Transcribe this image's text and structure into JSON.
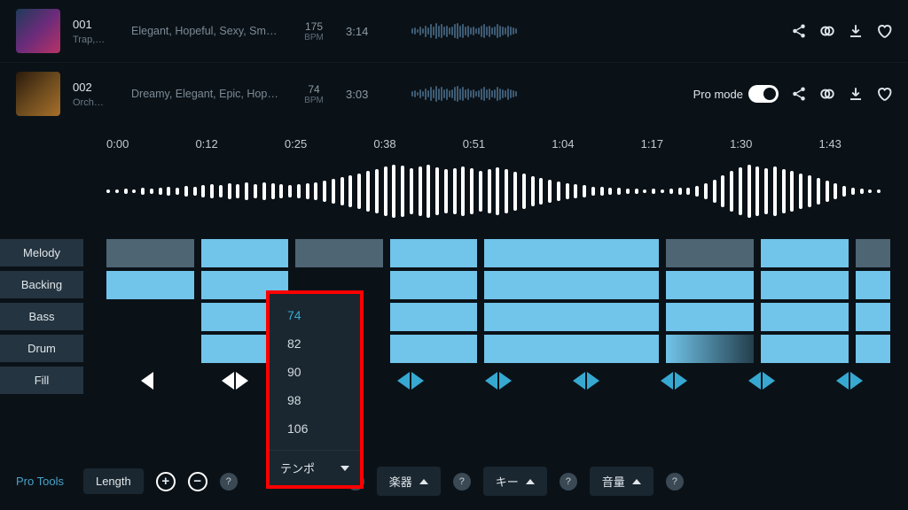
{
  "tracks": [
    {
      "num": "001",
      "genre": "Trap,…",
      "tags": "Elegant, Hopeful, Sexy, Smooth",
      "bpm": "175",
      "bpm_unit": "BPM",
      "duration": "3:14",
      "pro_mode": false
    },
    {
      "num": "002",
      "genre": "Orch…",
      "tags": "Dreamy, Elegant, Epic, Hopef…",
      "bpm": "74",
      "bpm_unit": "BPM",
      "duration": "3:03",
      "pro_mode": true,
      "pro_mode_label": "Pro mode"
    }
  ],
  "timeline": [
    "0:00",
    "0:12",
    "0:25",
    "0:38",
    "0:51",
    "1:04",
    "1:17",
    "1:30",
    "1:43"
  ],
  "lanes": {
    "melody": "Melody",
    "backing": "Backing",
    "bass": "Bass",
    "drum": "Drum",
    "fill": "Fill"
  },
  "tempo_menu": {
    "label": "テンポ",
    "selected": "74",
    "options": [
      "74",
      "82",
      "90",
      "98",
      "106"
    ]
  },
  "toolbar": {
    "title": "Pro Tools",
    "length": "Length",
    "tempo": "テンポ",
    "instrument": "楽器",
    "key": "キー",
    "volume": "音量"
  },
  "fill_markers": [
    {
      "left": true,
      "right": false,
      "color": "#ffffff"
    },
    {
      "left": true,
      "right": true,
      "color": "#ffffff"
    },
    {
      "left": true,
      "right": true,
      "color": "#ffffff"
    },
    {
      "left": true,
      "right": true,
      "color": "#37a9d1"
    },
    {
      "left": true,
      "right": true,
      "color": "#37a9d1"
    },
    {
      "left": true,
      "right": true,
      "color": "#37a9d1"
    },
    {
      "left": true,
      "right": true,
      "color": "#37a9d1"
    },
    {
      "left": true,
      "right": true,
      "color": "#37a9d1"
    },
    {
      "left": true,
      "right": true,
      "color": "#37a9d1"
    }
  ],
  "chart_data": {
    "type": "waveform",
    "note": "Decorative audio amplitude visualization; values are relative heights 0-1",
    "mini_wave": [
      0.2,
      0.3,
      0.15,
      0.4,
      0.25,
      0.5,
      0.3,
      0.6,
      0.4,
      0.7,
      0.5,
      0.6,
      0.4,
      0.5,
      0.3,
      0.4,
      0.6,
      0.7,
      0.5,
      0.6,
      0.4,
      0.5,
      0.3,
      0.4,
      0.2,
      0.3,
      0.5,
      0.6,
      0.4,
      0.5,
      0.3,
      0.4,
      0.6,
      0.5,
      0.4,
      0.3,
      0.5,
      0.4,
      0.3,
      0.2
    ],
    "big_wave": [
      0.08,
      0.06,
      0.1,
      0.08,
      0.12,
      0.1,
      0.14,
      0.18,
      0.12,
      0.2,
      0.16,
      0.22,
      0.28,
      0.24,
      0.3,
      0.26,
      0.32,
      0.28,
      0.34,
      0.3,
      0.26,
      0.22,
      0.26,
      0.3,
      0.34,
      0.4,
      0.46,
      0.52,
      0.6,
      0.68,
      0.76,
      0.84,
      0.92,
      1.0,
      0.96,
      0.88,
      0.94,
      1.0,
      0.9,
      0.82,
      0.88,
      0.94,
      0.86,
      0.78,
      0.84,
      0.9,
      0.82,
      0.74,
      0.66,
      0.58,
      0.5,
      0.42,
      0.36,
      0.3,
      0.26,
      0.22,
      0.18,
      0.16,
      0.14,
      0.12,
      0.1,
      0.1,
      0.08,
      0.1,
      0.08,
      0.1,
      0.12,
      0.14,
      0.2,
      0.3,
      0.44,
      0.6,
      0.76,
      0.9,
      1.0,
      0.94,
      0.86,
      0.92,
      0.84,
      0.76,
      0.68,
      0.6,
      0.5,
      0.4,
      0.3,
      0.2,
      0.12,
      0.1,
      0.08,
      0.06
    ]
  }
}
